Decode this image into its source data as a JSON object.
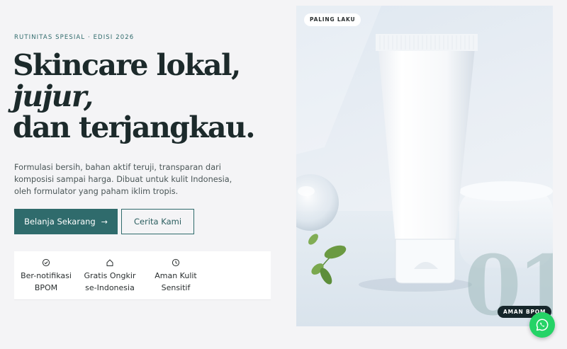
{
  "hero_text": {
    "eyebrow": "RUTINITAS SPESIAL · EDISI 2026",
    "headline_line1": "Skincare lokal,",
    "headline_line2": "jujur,",
    "headline_line3": "dan terjangkau.",
    "lead": "Formulasi bersih, bahan aktif teruji, transparan dari komposisi sampai harga. Dibuat untuk kulit Indonesia, oleh formulator yang paham iklim tropis."
  },
  "actions": {
    "primary_label": "Belanja Sekarang",
    "primary_icon": "arrow-right-icon",
    "secondary_label": "Cerita Kami"
  },
  "features": [
    {
      "icon": "check-circle-icon",
      "line1": "Ber-notifikasi",
      "line2": "BPOM"
    },
    {
      "icon": "home-icon",
      "line1": "Gratis Ongkir",
      "line2": "se-Indonesia"
    },
    {
      "icon": "clock-icon",
      "line1": "Aman Kulit",
      "line2": "Sensitif"
    }
  ],
  "hero_image": {
    "badge_top": "PALING LAKU",
    "number": "01",
    "badge_bottom": "AMAN BPOM"
  },
  "whatsapp": {
    "icon": "whatsapp-icon"
  },
  "colors": {
    "accent": "#2f6b6c",
    "heading": "#1c2a2b",
    "whatsapp": "#25d366"
  }
}
